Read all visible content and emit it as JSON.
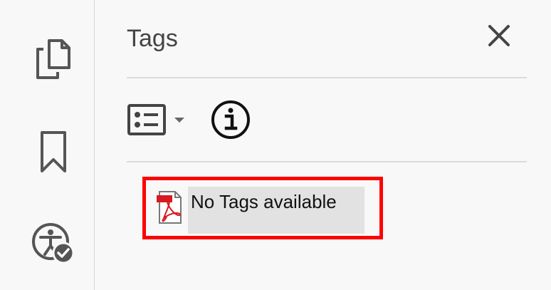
{
  "left_rail": {
    "items": [
      {
        "icon": "pages-icon"
      },
      {
        "icon": "bookmark-icon"
      },
      {
        "icon": "accessibility-check-icon"
      }
    ]
  },
  "panel": {
    "title": "Tags",
    "close_icon": "close-icon",
    "toolbar": {
      "options_icon": "tag-options-icon",
      "dropdown_icon": "chevron-down-icon",
      "info_icon": "info-icon"
    },
    "tree": {
      "root_icon": "pdf-file-icon",
      "root_label": "No Tags available"
    },
    "highlight_color": "#ff0000"
  }
}
